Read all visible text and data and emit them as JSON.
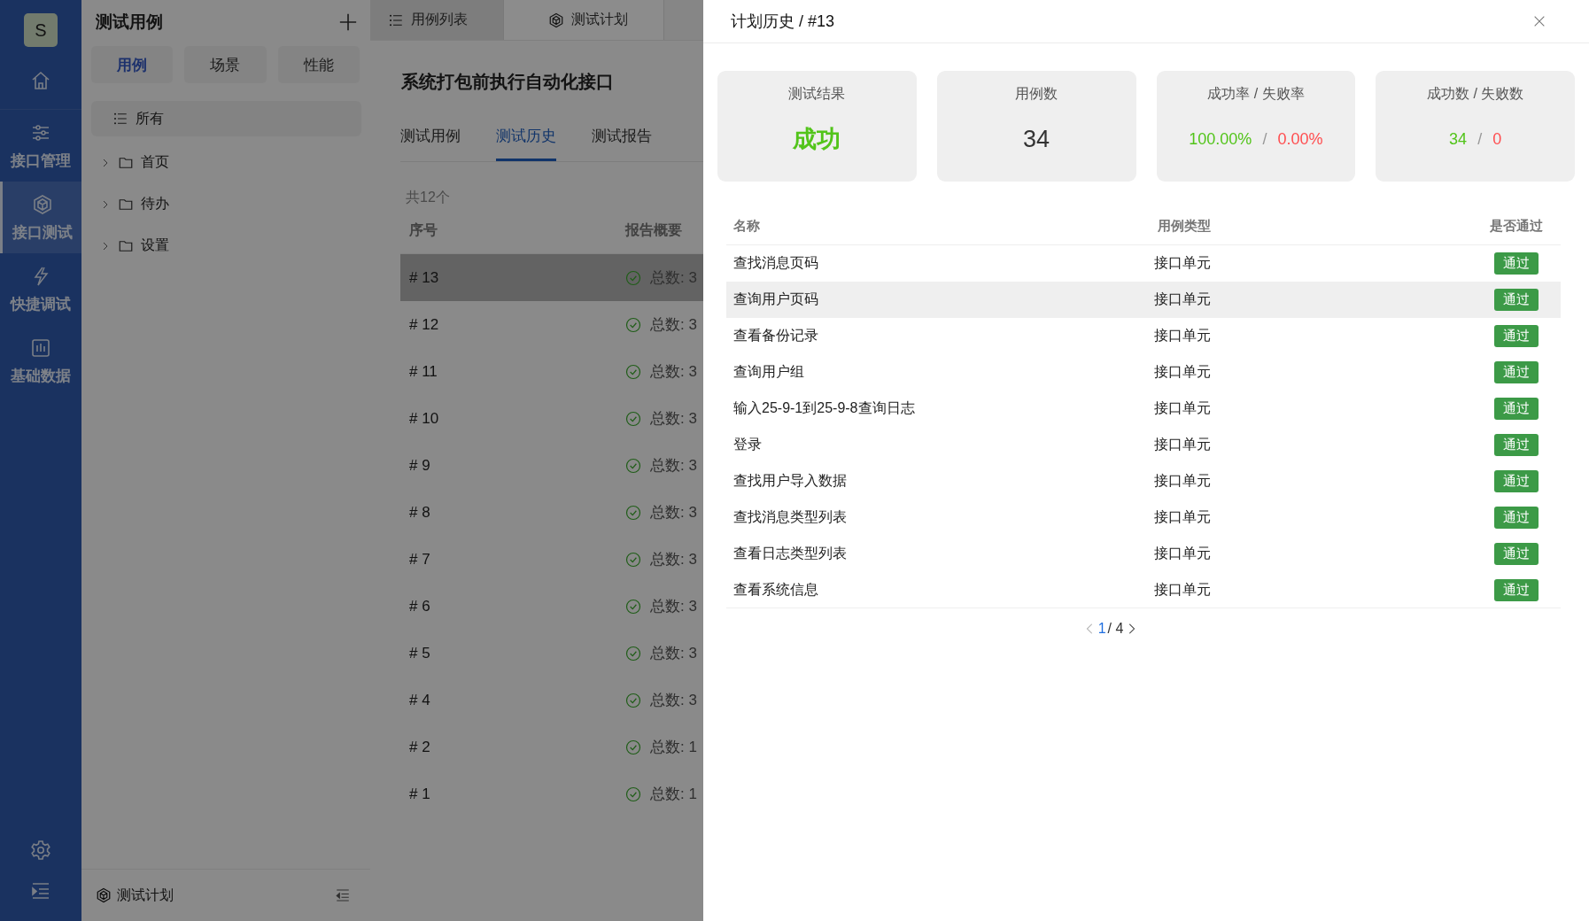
{
  "nav": {
    "avatar": "S",
    "items": [
      {
        "kind": "home",
        "selected": false
      },
      {
        "kind": "sliders",
        "label": "接口管理",
        "selected": false
      },
      {
        "kind": "cube",
        "label": "接口测试",
        "selected": true
      },
      {
        "kind": "bolt",
        "label": "快捷调试",
        "selected": false
      },
      {
        "kind": "chart",
        "label": "基础数据",
        "selected": false
      }
    ],
    "bottom": [
      {
        "kind": "gear"
      },
      {
        "kind": "menu"
      }
    ]
  },
  "tree_panel": {
    "title": "测试用例",
    "segments": [
      {
        "label": "用例",
        "selected": true
      },
      {
        "label": "场景",
        "selected": false
      },
      {
        "label": "性能",
        "selected": false
      }
    ],
    "items": [
      {
        "kind": "list",
        "label": "所有",
        "selected": true
      },
      {
        "kind": "folder",
        "label": "首页",
        "selected": false,
        "expanded": false
      },
      {
        "kind": "folder",
        "label": "待办",
        "selected": false,
        "expanded": false
      },
      {
        "kind": "folder",
        "label": "设置",
        "selected": false,
        "expanded": false
      }
    ],
    "footer": {
      "label": "测试计划"
    }
  },
  "main": {
    "tabs": [
      {
        "kind": "list",
        "label": "用例列表",
        "selected": false
      },
      {
        "kind": "cube",
        "label": "测试计划",
        "selected": true
      }
    ],
    "title": "系统打包前执行自动化接口",
    "sub_tabs": [
      {
        "label": "测试用例",
        "selected": false
      },
      {
        "label": "测试历史",
        "selected": true
      },
      {
        "label": "测试报告",
        "selected": false
      }
    ],
    "count": "共12个",
    "columns": [
      "序号",
      "报告概要"
    ],
    "rows": [
      {
        "number": "# 13",
        "summary": "总数: 3",
        "passed": true,
        "selected": true
      },
      {
        "number": "# 12",
        "summary": "总数: 3",
        "passed": true,
        "selected": false
      },
      {
        "number": "# 11",
        "summary": "总数: 3",
        "passed": true,
        "selected": false
      },
      {
        "number": "# 10",
        "summary": "总数: 3",
        "passed": true,
        "selected": false
      },
      {
        "number": "# 9",
        "summary": "总数: 3",
        "passed": true,
        "selected": false
      },
      {
        "number": "# 8",
        "summary": "总数: 3",
        "passed": true,
        "selected": false
      },
      {
        "number": "# 7",
        "summary": "总数: 3",
        "passed": true,
        "selected": false
      },
      {
        "number": "# 6",
        "summary": "总数: 3",
        "passed": true,
        "selected": false
      },
      {
        "number": "# 5",
        "summary": "总数: 3",
        "passed": true,
        "selected": false
      },
      {
        "number": "# 4",
        "summary": "总数: 3",
        "passed": true,
        "selected": false
      },
      {
        "number": "# 2",
        "summary": "总数: 1",
        "passed": true,
        "selected": false
      },
      {
        "number": "# 1",
        "summary": "总数: 1",
        "passed": true,
        "selected": false
      }
    ]
  },
  "drawer": {
    "title": "计划历史 / #13",
    "cards": [
      {
        "title": "测试结果",
        "kind": "status",
        "parts": [
          {
            "text": "成功",
            "color": "#52c41a"
          }
        ]
      },
      {
        "title": "用例数",
        "kind": "single",
        "parts": [
          {
            "text": "34",
            "color": "#333333"
          }
        ]
      },
      {
        "title": "成功率 / 失败率",
        "kind": "ratio",
        "parts": [
          {
            "text": "100.00%",
            "color": "#52c41a"
          },
          {
            "text": "/",
            "color": "#999999"
          },
          {
            "text": "0.00%",
            "color": "#ff4d4f"
          }
        ]
      },
      {
        "title": "成功数 / 失败数",
        "kind": "ratio",
        "parts": [
          {
            "text": "34",
            "color": "#52c41a"
          },
          {
            "text": "/",
            "color": "#999999"
          },
          {
            "text": "0",
            "color": "#ff4d4f"
          }
        ]
      }
    ],
    "columns": [
      "名称",
      "用例类型",
      "是否通过"
    ],
    "rows": [
      {
        "name": "查找消息页码",
        "type": "接口单元",
        "result": "通过",
        "passed": true,
        "selected": false
      },
      {
        "name": "查询用户页码",
        "type": "接口单元",
        "result": "通过",
        "passed": true,
        "selected": true
      },
      {
        "name": "查看备份记录",
        "type": "接口单元",
        "result": "通过",
        "passed": true,
        "selected": false
      },
      {
        "name": "查询用户组",
        "type": "接口单元",
        "result": "通过",
        "passed": true,
        "selected": false
      },
      {
        "name": "输入25-9-1到25-9-8查询日志",
        "type": "接口单元",
        "result": "通过",
        "passed": true,
        "selected": false
      },
      {
        "name": "登录",
        "type": "接口单元",
        "result": "通过",
        "passed": true,
        "selected": false
      },
      {
        "name": "查找用户导入数据",
        "type": "接口单元",
        "result": "通过",
        "passed": true,
        "selected": false
      },
      {
        "name": "查找消息类型列表",
        "type": "接口单元",
        "result": "通过",
        "passed": true,
        "selected": false
      },
      {
        "name": "查看日志类型列表",
        "type": "接口单元",
        "result": "通过",
        "passed": true,
        "selected": false
      },
      {
        "name": "查看系统信息",
        "type": "接口单元",
        "result": "通过",
        "passed": true,
        "selected": false
      }
    ],
    "pagination": {
      "current": "1",
      "total": "/ 4",
      "prev_disabled": true,
      "next_disabled": false
    }
  }
}
